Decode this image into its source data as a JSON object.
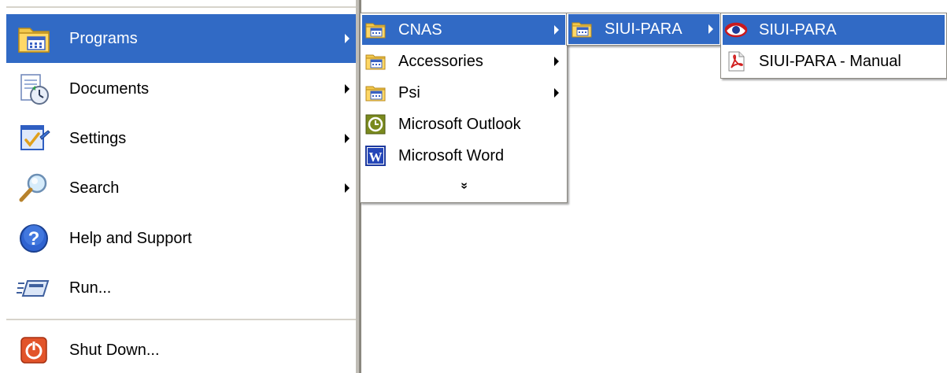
{
  "main_menu": {
    "items": [
      {
        "label": "Programs",
        "icon": "programs-folder-icon",
        "has_submenu": true,
        "highlighted": true
      },
      {
        "label": "Documents",
        "icon": "documents-icon",
        "has_submenu": true
      },
      {
        "label": "Settings",
        "icon": "settings-icon",
        "has_submenu": true
      },
      {
        "label": "Search",
        "icon": "search-icon",
        "has_submenu": true
      },
      {
        "label": "Help and Support",
        "icon": "help-icon",
        "has_submenu": false
      },
      {
        "label": "Run...",
        "icon": "run-icon",
        "has_submenu": false
      }
    ],
    "shutdown": {
      "label": "Shut Down...",
      "icon": "shutdown-icon"
    }
  },
  "programs_menu": {
    "items": [
      {
        "label": "CNAS",
        "icon": "programs-folder-icon",
        "has_submenu": true,
        "highlighted": true
      },
      {
        "label": "Accessories",
        "icon": "programs-folder-icon",
        "has_submenu": true
      },
      {
        "label": "Psi",
        "icon": "programs-folder-icon",
        "has_submenu": true
      },
      {
        "label": "Microsoft Outlook",
        "icon": "outlook-icon",
        "has_submenu": false
      },
      {
        "label": "Microsoft Word",
        "icon": "word-icon",
        "has_submenu": false
      }
    ],
    "expand_glyph": "»"
  },
  "cnas_menu": {
    "items": [
      {
        "label": "SIUI-PARA",
        "icon": "programs-folder-icon",
        "has_submenu": true,
        "highlighted": true
      }
    ]
  },
  "siui_menu": {
    "items": [
      {
        "label": "SIUI-PARA",
        "icon": "siui-app-icon",
        "highlighted": true
      },
      {
        "label": "SIUI-PARA - Manual",
        "icon": "pdf-icon"
      }
    ]
  },
  "colors": {
    "highlight": "#316ac5",
    "highlight_text": "#ffffff",
    "menu_background": "#ffffff"
  }
}
